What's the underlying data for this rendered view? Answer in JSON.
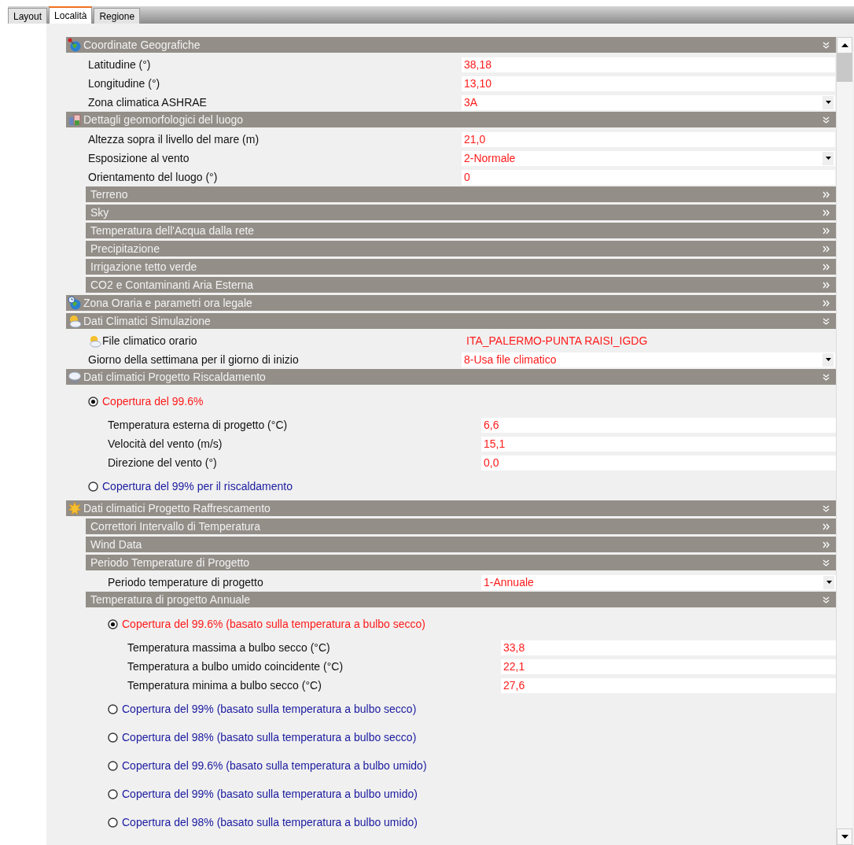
{
  "tabs": [
    {
      "label": "Layout",
      "selected": false
    },
    {
      "label": "Località",
      "selected": true
    },
    {
      "label": "Regione",
      "selected": false
    }
  ],
  "sections": [
    {
      "title": "Coordinate Geografiche",
      "expanded": true,
      "children": [
        {
          "kind": "field",
          "label": "Latitudine (°)",
          "value": "38,18",
          "dropdown": false
        },
        {
          "kind": "field",
          "label": "Longitudine (°)",
          "value": "13,10",
          "dropdown": false
        },
        {
          "kind": "field",
          "label": "Zona climatica ASHRAE",
          "value": "3A",
          "dropdown": true
        }
      ]
    },
    {
      "title": "Dettagli geomorfologici del luogo",
      "expanded": true,
      "children": [
        {
          "kind": "field",
          "label": "Altezza sopra il livello del mare (m)",
          "value": "21,0",
          "dropdown": false
        },
        {
          "kind": "field",
          "label": "Esposizione al vento",
          "value": "2-Normale",
          "dropdown": true
        },
        {
          "kind": "field",
          "label": "Orientamento del luogo (°)",
          "value": "0",
          "dropdown": false
        },
        {
          "kind": "header",
          "title": "Terreno",
          "expanded": false
        },
        {
          "kind": "header",
          "title": "Sky",
          "expanded": false
        },
        {
          "kind": "header",
          "title": "Temperatura dell'Acqua dalla rete",
          "expanded": false
        },
        {
          "kind": "header",
          "title": "Precipitazione",
          "expanded": false
        },
        {
          "kind": "header",
          "title": "Irrigazione tetto verde",
          "expanded": false
        },
        {
          "kind": "header",
          "title": "CO2 e Contaminanti Aria Esterna",
          "expanded": false
        }
      ]
    },
    {
      "title": "Zona Oraria e parametri ora legale",
      "expanded": false
    },
    {
      "title": "Dati Climatici Simulazione",
      "expanded": true,
      "children": [
        {
          "kind": "file",
          "label": "File climatico orario",
          "value": "ITA_PALERMO-PUNTA RAISI_IGDG"
        },
        {
          "kind": "field",
          "label": "Giorno della settimana per il giorno di inizio",
          "value": "8-Usa file climatico",
          "dropdown": true
        }
      ]
    },
    {
      "title": "Dati climatici Progetto Riscaldamento",
      "expanded": true,
      "children": [
        {
          "kind": "radio",
          "label": "Copertura del 99.6%",
          "selected": true,
          "children": [
            {
              "kind": "field",
              "label": "Temperatura esterna di progetto (°C)",
              "value": "6,6",
              "dropdown": false
            },
            {
              "kind": "field",
              "label": "Velocità del vento (m/s)",
              "value": "15,1",
              "dropdown": false
            },
            {
              "kind": "field",
              "label": "Direzione del vento (°)",
              "value": "0,0",
              "dropdown": false
            }
          ]
        },
        {
          "kind": "radio",
          "label": "Copertura del 99% per il riscaldamento",
          "selected": false
        }
      ]
    },
    {
      "title": "Dati climatici Progetto Raffrescamento",
      "expanded": true,
      "children": [
        {
          "kind": "header",
          "title": "Correttori Intervallo di Temperatura",
          "expanded": false
        },
        {
          "kind": "header",
          "title": "Wind Data",
          "expanded": false
        },
        {
          "kind": "header",
          "title": "Periodo Temperature di Progetto",
          "expanded": true,
          "children": [
            {
              "kind": "field",
              "label": "Periodo temperature di progetto",
              "value": "1-Annuale",
              "dropdown": true
            }
          ]
        },
        {
          "kind": "header",
          "title": "Temperatura di progetto Annuale",
          "expanded": true,
          "children": [
            {
              "kind": "radio",
              "label": "Copertura del 99.6% (basato sulla temperatura a bulbo secco)",
              "selected": true,
              "children": [
                {
                  "kind": "field",
                  "label": "Temperatura massima a bulbo secco (°C)",
                  "value": "33,8",
                  "dropdown": false
                },
                {
                  "kind": "field",
                  "label": "Temperatura a bulbo umido coincidente (°C)",
                  "value": "22,1",
                  "dropdown": false
                },
                {
                  "kind": "field",
                  "label": "Temperatura minima a bulbo secco (°C)",
                  "value": "27,6",
                  "dropdown": false
                }
              ]
            },
            {
              "kind": "radio",
              "label": "Copertura del 99% (basato sulla temperatura a bulbo secco)",
              "selected": false
            },
            {
              "kind": "radio",
              "label": "Copertura del 98% (basato sulla temperatura a bulbo secco)",
              "selected": false
            },
            {
              "kind": "radio",
              "label": "Copertura del 99.6% (basato sulla temperatura a bulbo umido)",
              "selected": false
            },
            {
              "kind": "radio",
              "label": "Copertura del 99% (basato sulla temperatura a bulbo umido)",
              "selected": false
            },
            {
              "kind": "radio",
              "label": "Copertura del 98% (basato sulla temperatura a bulbo umido)",
              "selected": false
            }
          ]
        }
      ]
    }
  ]
}
